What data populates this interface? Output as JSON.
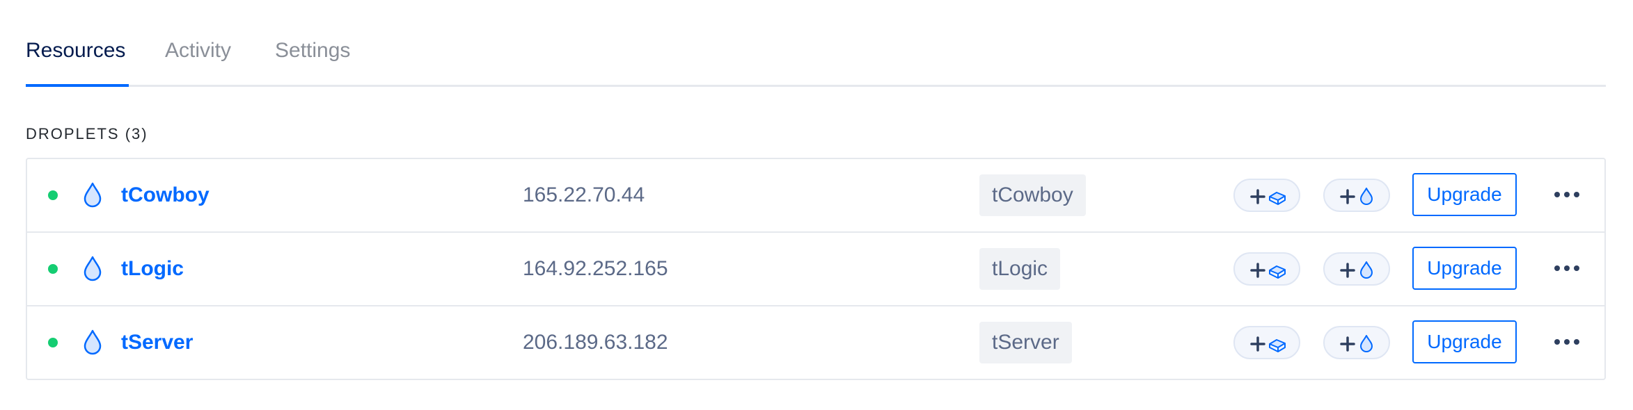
{
  "tabs": [
    {
      "label": "Resources",
      "active": true
    },
    {
      "label": "Activity",
      "active": false
    },
    {
      "label": "Settings",
      "active": false
    }
  ],
  "section": {
    "title": "DROPLETS (3)"
  },
  "droplets": [
    {
      "name": "tCowboy",
      "ip": "165.22.70.44",
      "tag": "tCowboy",
      "status": "active",
      "upgrade_label": "Upgrade"
    },
    {
      "name": "tLogic",
      "ip": "164.92.252.165",
      "tag": "tLogic",
      "status": "active",
      "upgrade_label": "Upgrade"
    },
    {
      "name": "tServer",
      "ip": "206.189.63.182",
      "tag": "tServer",
      "status": "active",
      "upgrade_label": "Upgrade"
    }
  ],
  "icons": {
    "droplet": "droplet-icon",
    "add_volume": "add-volume-icon",
    "add_droplet": "add-droplet-icon",
    "more": "more-options-icon",
    "status": "status-dot"
  },
  "colors": {
    "accent": "#0069ff",
    "status_active": "#15cd72",
    "text_primary": "#031b4e",
    "text_muted": "#8a8f98",
    "border": "#e5e8ed"
  }
}
